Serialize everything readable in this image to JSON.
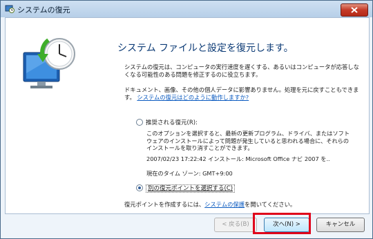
{
  "window": {
    "title": "システムの復元"
  },
  "main": {
    "heading": "システム ファイルと設定を復元します。",
    "paragraph1": "システムの復元は、コンピュータの実行速度を遅くする、あるいはコンピュータが応答しなくなる可能性のある問題を修正するのに役立ちます。",
    "paragraph2_text": "ドキュメント、画像、その他の個人データに影響ありません。処理を元に戻すこともできます。",
    "paragraph2_link": "システムの復元はどのように動作しますか?",
    "option_recommended": {
      "label": "推奨される復元(R):",
      "description": "このオプションを選択すると、最新の更新プログラム、ドライバ、またはソフトウェアのインストールによって問題が発生していると思われる場合に、それらのインストールを取り消すことができます。",
      "restore_point": "2007/02/23 17:22:42 インストール: Microsoft Office ナビ 2007 を..",
      "timezone": "現在のタイム ゾーン: GMT+9:00"
    },
    "option_other": {
      "label": "別の復元ポイントを選択する(C)",
      "selected": true
    },
    "bottom_text_before": "復元ポイントを作成するには、",
    "bottom_link": "システムの保護",
    "bottom_text_after": "を開いてください。"
  },
  "buttons": {
    "back": "< 戻る(B)",
    "next": "次へ(N) >",
    "cancel": "キャンセル"
  },
  "colors": {
    "highlight": "#e0001a",
    "heading": "#0b3a75",
    "link": "#0a5ac0"
  }
}
